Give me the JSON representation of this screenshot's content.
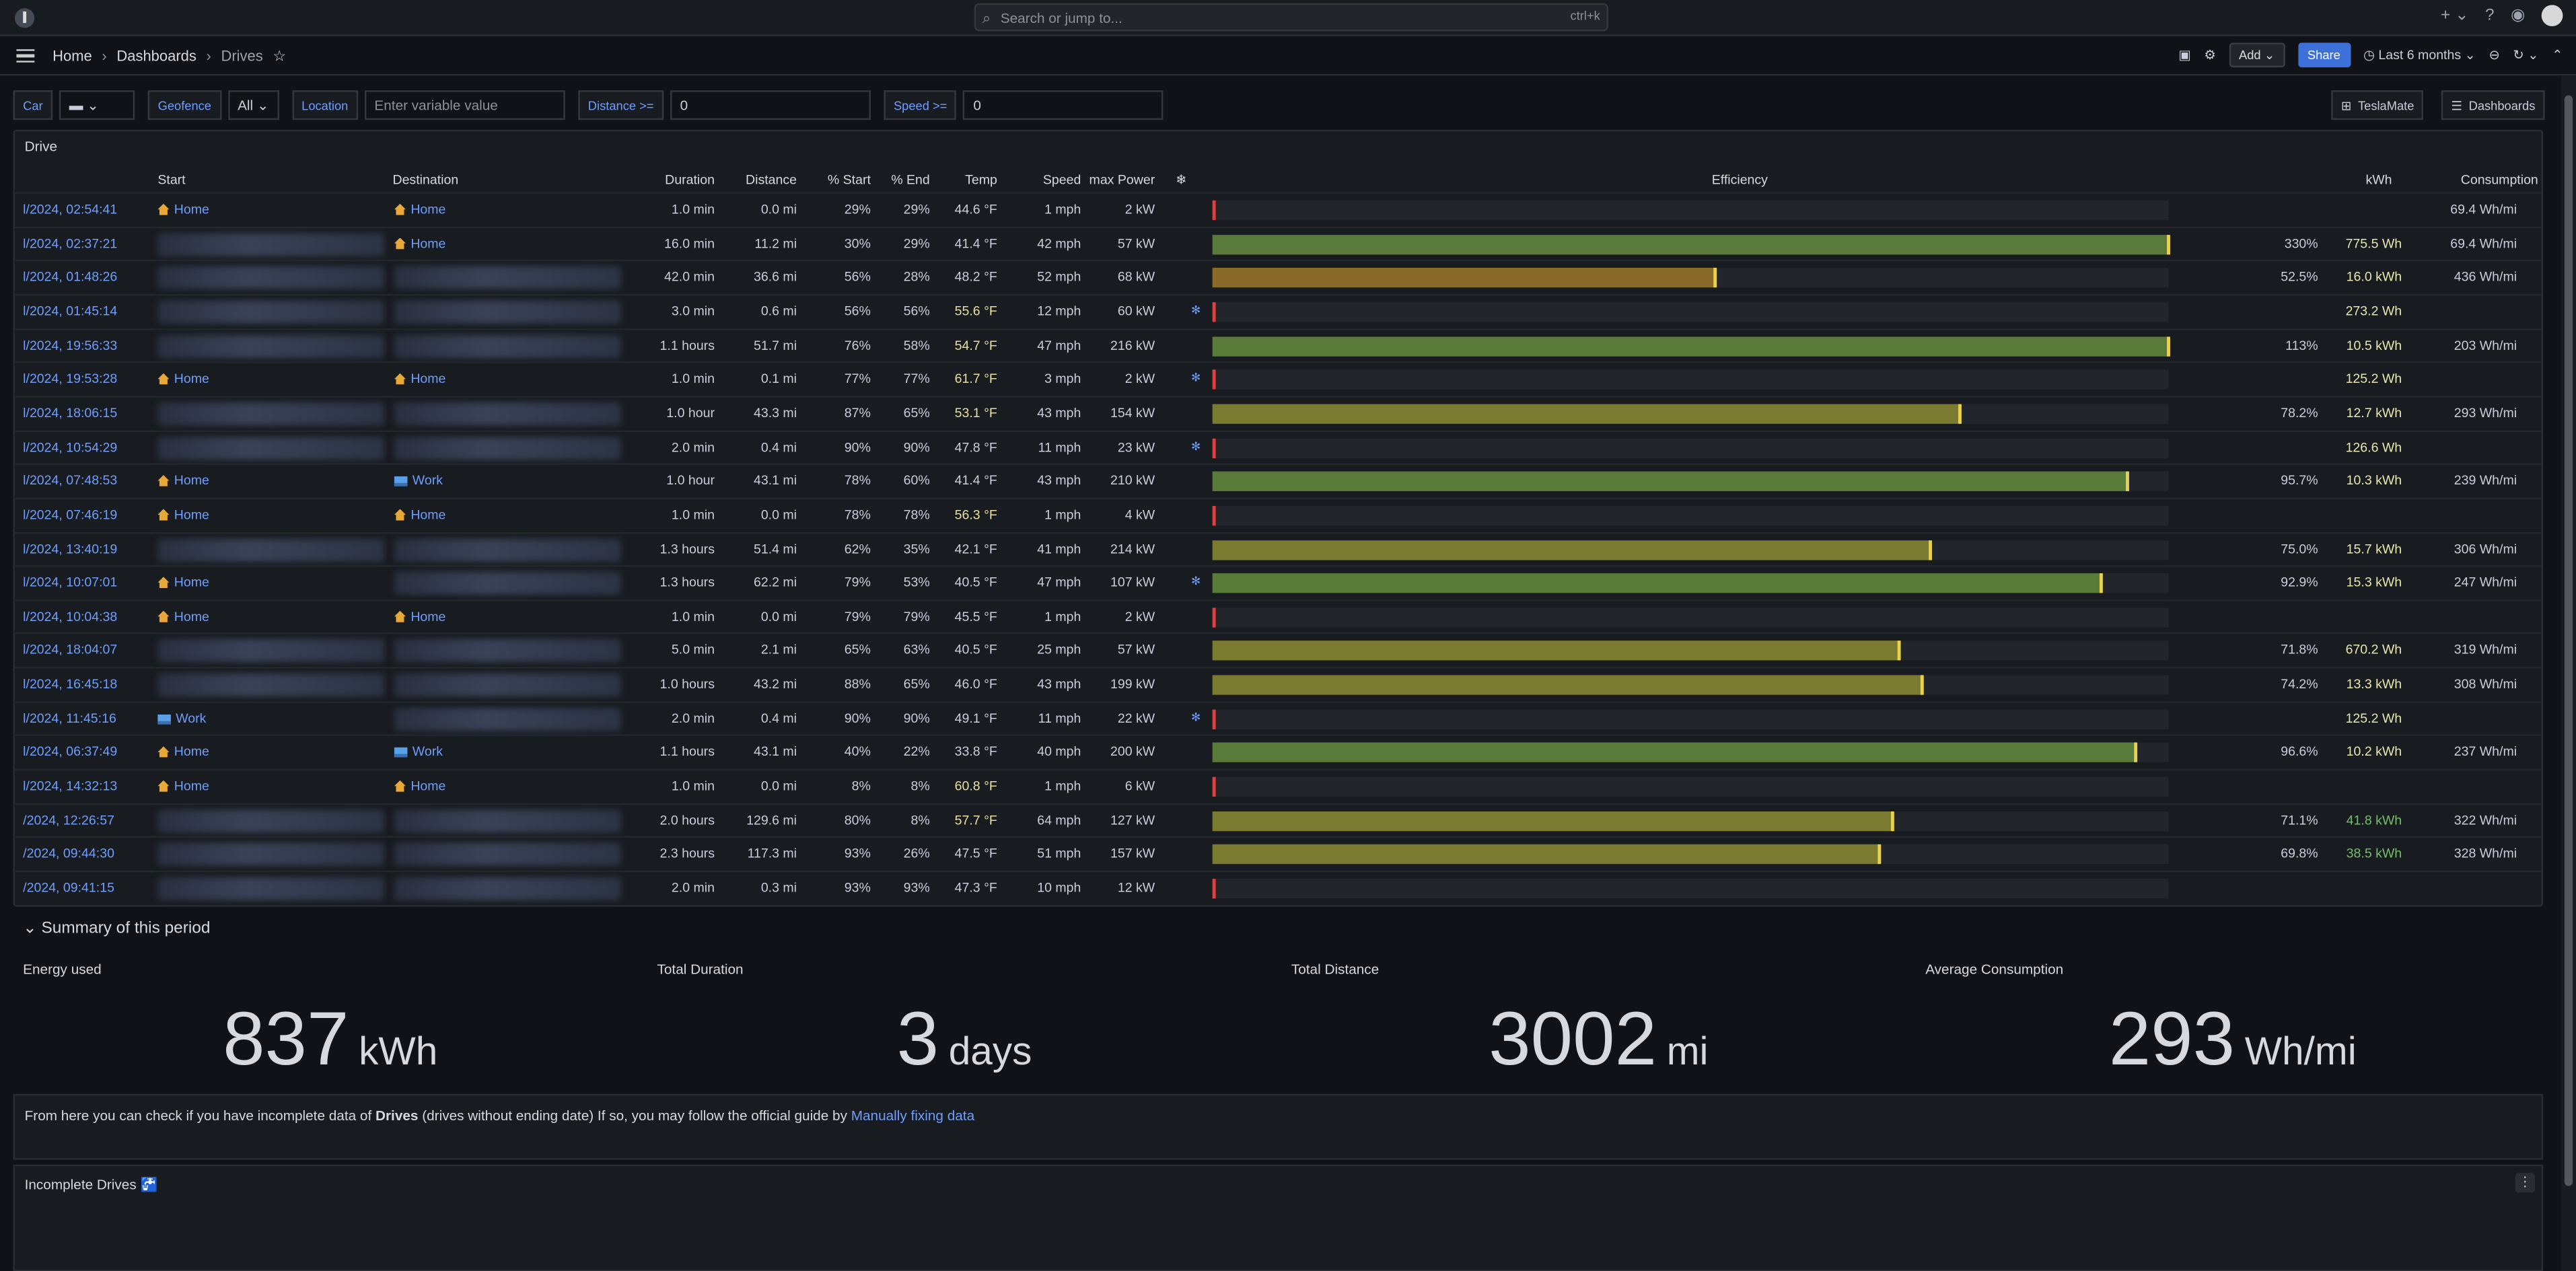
{
  "search": {
    "placeholder": "Search or jump to...",
    "shortcut": "ctrl+k"
  },
  "breadcrumb": [
    "Home",
    "Dashboards",
    "Drives"
  ],
  "toolbar": {
    "add": "Add",
    "share": "Share",
    "time_range": "Last 6 months"
  },
  "vars": {
    "car_label": "Car",
    "geofence_label": "Geofence",
    "geofence_value": "All",
    "location_label": "Location",
    "location_placeholder": "Enter variable value",
    "distance_label": "Distance >=",
    "distance_value": "0",
    "speed_label": "Speed >=",
    "speed_value": "0"
  },
  "links": {
    "teslamate": "TeslaMate",
    "dashboards": "Dashboards"
  },
  "table": {
    "title": "Drive",
    "headers": [
      "Start",
      "Destination",
      "Duration",
      "Distance",
      "% Start",
      "% End",
      "Temp",
      "Speed",
      "max Power",
      "❄",
      "Efficiency",
      "kWh",
      "Consumption"
    ],
    "rows": [
      {
        "date": "l/2024, 02:54:41",
        "start": "Home",
        "start_icon": "home",
        "dest": "Home",
        "dest_icon": "home",
        "dur": "1.0 min",
        "dist": "0.0 mi",
        "ps": "29%",
        "pe": "29%",
        "temp": "44.6 °F",
        "speed": "1 mph",
        "power": "2 kW",
        "snow": false,
        "eff": 0.0,
        "effp": "",
        "kwh": "",
        "cons": "69.4 Wh/mi"
      },
      {
        "date": "l/2024, 02:37:21",
        "start": "",
        "start_icon": "blur",
        "dest": "Home",
        "dest_icon": "home",
        "dur": "16.0 min",
        "dist": "11.2 mi",
        "ps": "30%",
        "pe": "29%",
        "temp": "41.4 °F",
        "speed": "42 mph",
        "power": "57 kW",
        "snow": false,
        "eff": 1.0,
        "effp": "330%",
        "kwh": "775.5 Wh",
        "cons": "69.4 Wh/mi"
      },
      {
        "date": "l/2024, 01:48:26",
        "start": "",
        "start_icon": "blur",
        "dest": "",
        "dest_icon": "blur",
        "dur": "42.0 min",
        "dist": "36.6 mi",
        "ps": "56%",
        "pe": "28%",
        "temp": "48.2 °F",
        "speed": "52 mph",
        "power": "68 kW",
        "snow": false,
        "eff": 0.525,
        "effp": "52.5%",
        "kwh": "16.0 kWh",
        "cons": "436 Wh/mi"
      },
      {
        "date": "l/2024, 01:45:14",
        "start": "",
        "start_icon": "blur",
        "dest": "",
        "dest_icon": "blur",
        "dur": "3.0 min",
        "dist": "0.6 mi",
        "ps": "56%",
        "pe": "56%",
        "temp": "55.6 °F",
        "speed": "12 mph",
        "power": "60 kW",
        "snow": true,
        "eff": 0.0,
        "effp": "",
        "kwh": "273.2 Wh",
        "cons": ""
      },
      {
        "date": "l/2024, 19:56:33",
        "start": "",
        "start_icon": "blur",
        "dest": "",
        "dest_icon": "blur",
        "dur": "1.1 hours",
        "dist": "51.7 mi",
        "ps": "76%",
        "pe": "58%",
        "temp": "54.7 °F",
        "speed": "47 mph",
        "power": "216 kW",
        "snow": false,
        "eff": 1.0,
        "effp": "113%",
        "kwh": "10.5 kWh",
        "cons": "203 Wh/mi"
      },
      {
        "date": "l/2024, 19:53:28",
        "start": "Home",
        "start_icon": "home",
        "dest": "Home",
        "dest_icon": "home",
        "dur": "1.0 min",
        "dist": "0.1 mi",
        "ps": "77%",
        "pe": "77%",
        "temp": "61.7 °F",
        "speed": "3 mph",
        "power": "2 kW",
        "snow": true,
        "eff": 0.0,
        "effp": "",
        "kwh": "125.2 Wh",
        "cons": ""
      },
      {
        "date": "l/2024, 18:06:15",
        "start": "",
        "start_icon": "blur",
        "dest": "",
        "dest_icon": "blur",
        "dur": "1.0 hour",
        "dist": "43.3 mi",
        "ps": "87%",
        "pe": "65%",
        "temp": "53.1 °F",
        "speed": "43 mph",
        "power": "154 kW",
        "snow": false,
        "eff": 0.782,
        "effp": "78.2%",
        "kwh": "12.7 kWh",
        "cons": "293 Wh/mi"
      },
      {
        "date": "l/2024, 10:54:29",
        "start": "",
        "start_icon": "blur",
        "dest": "",
        "dest_icon": "blur",
        "dur": "2.0 min",
        "dist": "0.4 mi",
        "ps": "90%",
        "pe": "90%",
        "temp": "47.8 °F",
        "speed": "11 mph",
        "power": "23 kW",
        "snow": true,
        "eff": 0.0,
        "effp": "",
        "kwh": "126.6 Wh",
        "cons": ""
      },
      {
        "date": "l/2024, 07:48:53",
        "start": "Home",
        "start_icon": "home",
        "dest": "Work",
        "dest_icon": "work",
        "dur": "1.0 hour",
        "dist": "43.1 mi",
        "ps": "78%",
        "pe": "60%",
        "temp": "41.4 °F",
        "speed": "43 mph",
        "power": "210 kW",
        "snow": false,
        "eff": 0.957,
        "effp": "95.7%",
        "kwh": "10.3 kWh",
        "cons": "239 Wh/mi"
      },
      {
        "date": "l/2024, 07:46:19",
        "start": "Home",
        "start_icon": "home",
        "dest": "Home",
        "dest_icon": "home",
        "dur": "1.0 min",
        "dist": "0.0 mi",
        "ps": "78%",
        "pe": "78%",
        "temp": "56.3 °F",
        "speed": "1 mph",
        "power": "4 kW",
        "snow": false,
        "eff": 0.0,
        "effp": "",
        "kwh": "",
        "cons": ""
      },
      {
        "date": "l/2024, 13:40:19",
        "start": "",
        "start_icon": "blur",
        "dest": "",
        "dest_icon": "blur",
        "dur": "1.3 hours",
        "dist": "51.4 mi",
        "ps": "62%",
        "pe": "35%",
        "temp": "42.1 °F",
        "speed": "41 mph",
        "power": "214 kW",
        "snow": false,
        "eff": 0.75,
        "effp": "75.0%",
        "kwh": "15.7 kWh",
        "cons": "306 Wh/mi"
      },
      {
        "date": "l/2024, 10:07:01",
        "start": "Home",
        "start_icon": "home",
        "dest": "",
        "dest_icon": "blur",
        "dur": "1.3 hours",
        "dist": "62.2 mi",
        "ps": "79%",
        "pe": "53%",
        "temp": "40.5 °F",
        "speed": "47 mph",
        "power": "107 kW",
        "snow": true,
        "eff": 0.929,
        "effp": "92.9%",
        "kwh": "15.3 kWh",
        "cons": "247 Wh/mi"
      },
      {
        "date": "l/2024, 10:04:38",
        "start": "Home",
        "start_icon": "home",
        "dest": "Home",
        "dest_icon": "home",
        "dur": "1.0 min",
        "dist": "0.0 mi",
        "ps": "79%",
        "pe": "79%",
        "temp": "45.5 °F",
        "speed": "1 mph",
        "power": "2 kW",
        "snow": false,
        "eff": 0.0,
        "effp": "",
        "kwh": "",
        "cons": ""
      },
      {
        "date": "l/2024, 18:04:07",
        "start": "",
        "start_icon": "blur",
        "dest": "",
        "dest_icon": "blur",
        "dur": "5.0 min",
        "dist": "2.1 mi",
        "ps": "65%",
        "pe": "63%",
        "temp": "40.5 °F",
        "speed": "25 mph",
        "power": "57 kW",
        "snow": false,
        "eff": 0.718,
        "effp": "71.8%",
        "kwh": "670.2 Wh",
        "cons": "319 Wh/mi"
      },
      {
        "date": "l/2024, 16:45:18",
        "start": "",
        "start_icon": "blur",
        "dest": "",
        "dest_icon": "blur",
        "dur": "1.0 hours",
        "dist": "43.2 mi",
        "ps": "88%",
        "pe": "65%",
        "temp": "46.0 °F",
        "speed": "43 mph",
        "power": "199 kW",
        "snow": false,
        "eff": 0.742,
        "effp": "74.2%",
        "kwh": "13.3 kWh",
        "cons": "308 Wh/mi"
      },
      {
        "date": "l/2024, 11:45:16",
        "start": "Work",
        "start_icon": "work",
        "dest": "",
        "dest_icon": "blur",
        "dur": "2.0 min",
        "dist": "0.4 mi",
        "ps": "90%",
        "pe": "90%",
        "temp": "49.1 °F",
        "speed": "11 mph",
        "power": "22 kW",
        "snow": true,
        "eff": 0.0,
        "effp": "",
        "kwh": "125.2 Wh",
        "cons": ""
      },
      {
        "date": "l/2024, 06:37:49",
        "start": "Home",
        "start_icon": "home",
        "dest": "Work",
        "dest_icon": "work",
        "dur": "1.1 hours",
        "dist": "43.1 mi",
        "ps": "40%",
        "pe": "22%",
        "temp": "33.8 °F",
        "speed": "40 mph",
        "power": "200 kW",
        "snow": false,
        "eff": 0.966,
        "effp": "96.6%",
        "kwh": "10.2 kWh",
        "cons": "237 Wh/mi"
      },
      {
        "date": "l/2024, 14:32:13",
        "start": "Home",
        "start_icon": "home",
        "dest": "Home",
        "dest_icon": "home",
        "dur": "1.0 min",
        "dist": "0.0 mi",
        "ps": "8%",
        "pe": "8%",
        "temp": "60.8 °F",
        "speed": "1 mph",
        "power": "6 kW",
        "snow": false,
        "eff": 0.0,
        "effp": "",
        "kwh": "",
        "cons": ""
      },
      {
        "date": "/2024, 12:26:57",
        "start": "",
        "start_icon": "blur",
        "dest": "",
        "dest_icon": "blur",
        "dur": "2.0 hours",
        "dist": "129.6 mi",
        "ps": "80%",
        "pe": "8%",
        "temp": "57.7 °F",
        "speed": "64 mph",
        "power": "127 kW",
        "snow": false,
        "eff": 0.711,
        "effp": "71.1%",
        "kwh": "41.8 kWh",
        "cons": "322 Wh/mi"
      },
      {
        "date": "/2024, 09:44:30",
        "start": "",
        "start_icon": "blur",
        "dest": "",
        "dest_icon": "blur",
        "dur": "2.3 hours",
        "dist": "117.3 mi",
        "ps": "93%",
        "pe": "26%",
        "temp": "47.5 °F",
        "speed": "51 mph",
        "power": "157 kW",
        "snow": false,
        "eff": 0.698,
        "effp": "69.8%",
        "kwh": "38.5 kWh",
        "cons": "328 Wh/mi"
      },
      {
        "date": "/2024, 09:41:15",
        "start": "",
        "start_icon": "blur",
        "dest": "",
        "dest_icon": "blur",
        "dur": "2.0 min",
        "dist": "0.3 mi",
        "ps": "93%",
        "pe": "93%",
        "temp": "47.3 °F",
        "speed": "10 mph",
        "power": "12 kW",
        "snow": false,
        "eff": 0.0,
        "effp": "",
        "kwh": "",
        "cons": ""
      }
    ]
  },
  "summary": {
    "title": "Summary of this period",
    "stats": [
      {
        "label": "Energy used",
        "value": "837",
        "unit": "kWh"
      },
      {
        "label": "Total Duration",
        "value": "3",
        "unit": "days"
      },
      {
        "label": "Total Distance",
        "value": "3002",
        "unit": "mi"
      },
      {
        "label": "Average Consumption",
        "value": "293",
        "unit": "Wh/mi"
      }
    ]
  },
  "info": {
    "text_before": "From here you can check if you have incomplete data of ",
    "bold": "Drives",
    "text_mid": " (drives without ending date) If so, you may follow the official guide by ",
    "link": "Manually fixing data"
  },
  "incomplete": {
    "title": "Incomplete Drives 🚰"
  },
  "colors": {
    "bar_green": "#5a7a3a",
    "bar_olive": "#7a7a30",
    "bar_amber": "#8a6a28",
    "accent_blue": "#6e9fff",
    "marker_red": "#e04040"
  }
}
